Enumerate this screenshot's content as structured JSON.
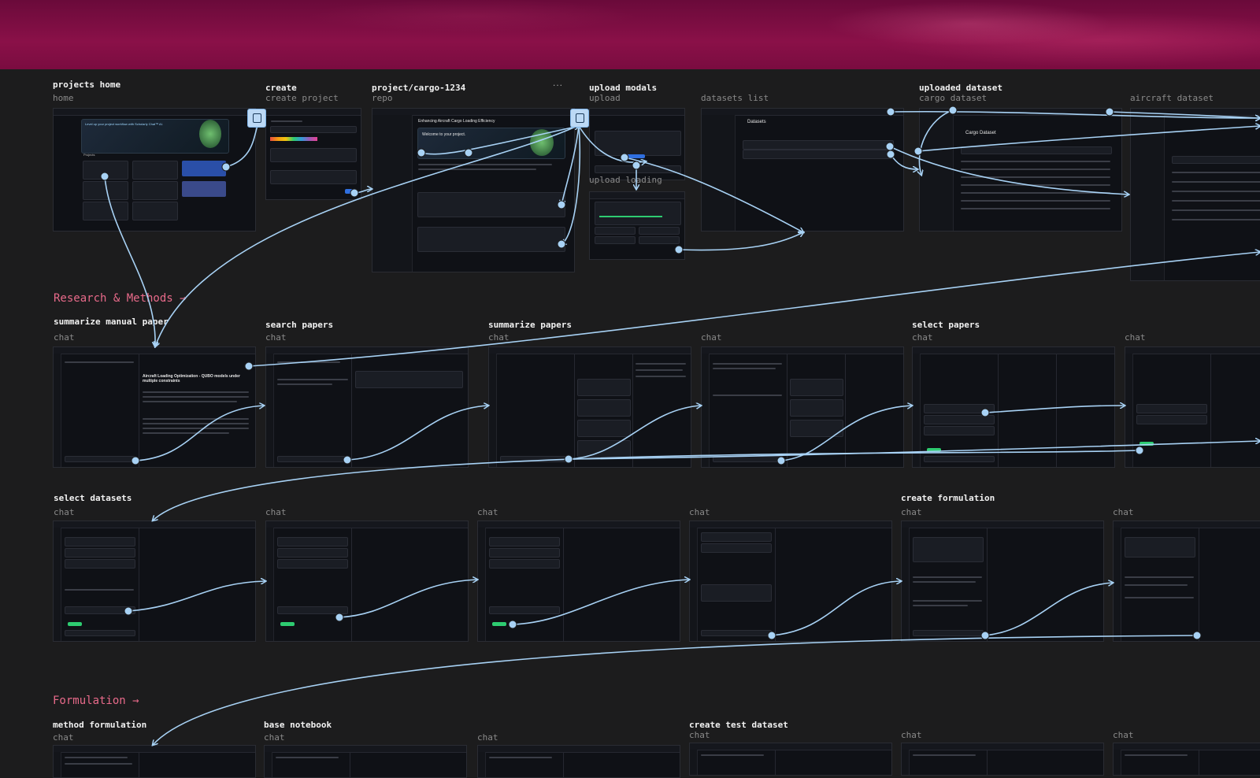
{
  "sections": {
    "research": "Research & Methods →",
    "formulation": "Formulation →"
  },
  "row1": [
    {
      "title": "projects home",
      "sub": "home"
    },
    {
      "title": "create",
      "sub": "create project"
    },
    {
      "title": "project/cargo-1234",
      "sub": "repo"
    },
    {
      "title": "upload modals",
      "sub": "upload"
    },
    {
      "title": "",
      "sub": "datasets list"
    },
    {
      "title": "uploaded dataset",
      "sub": "cargo dataset"
    },
    {
      "title": "",
      "sub": "aircraft dataset"
    }
  ],
  "upload_loading": "upload loading",
  "row1_more": "...",
  "row2": [
    {
      "title": "summarize manual paper",
      "sub": "chat"
    },
    {
      "title": "search papers",
      "sub": "chat"
    },
    {
      "title": "summarize papers",
      "sub": "chat"
    },
    {
      "title": "",
      "sub": "chat"
    },
    {
      "title": "select papers",
      "sub": "chat"
    },
    {
      "title": "",
      "sub": "chat"
    }
  ],
  "row3": [
    {
      "title": "select datasets",
      "sub": "chat"
    },
    {
      "title": "",
      "sub": "chat"
    },
    {
      "title": "",
      "sub": "chat"
    },
    {
      "title": "",
      "sub": "chat"
    },
    {
      "title": "create formulation",
      "sub": "chat"
    },
    {
      "title": "",
      "sub": "chat"
    }
  ],
  "row4": [
    {
      "title": "method formulation",
      "sub": "chat"
    },
    {
      "title": "base notebook",
      "sub": "chat"
    },
    {
      "title": "",
      "sub": "chat"
    },
    {
      "title": "create test dataset",
      "sub": "chat"
    },
    {
      "title": "",
      "sub": "chat"
    },
    {
      "title": "",
      "sub": "chat"
    }
  ],
  "screens": {
    "home_headline": "Level up your project workflow with Scholarly Chat™ AI.",
    "home_projects": "Projects",
    "repo_title": "Enhancing Aircraft Cargo Loading Efficiency",
    "repo_welcome": "Welcome to your project.",
    "datasets_title": "Datasets",
    "cargo_title": "Cargo Dataset",
    "paper_title": "Aircraft Loading Optimization - QUBO models under multiple constraints"
  },
  "colors": {
    "banner": "#7a0c40",
    "connector": "#a8d2f5",
    "section": "#e86a8a",
    "bg": "#1c1c1d"
  }
}
